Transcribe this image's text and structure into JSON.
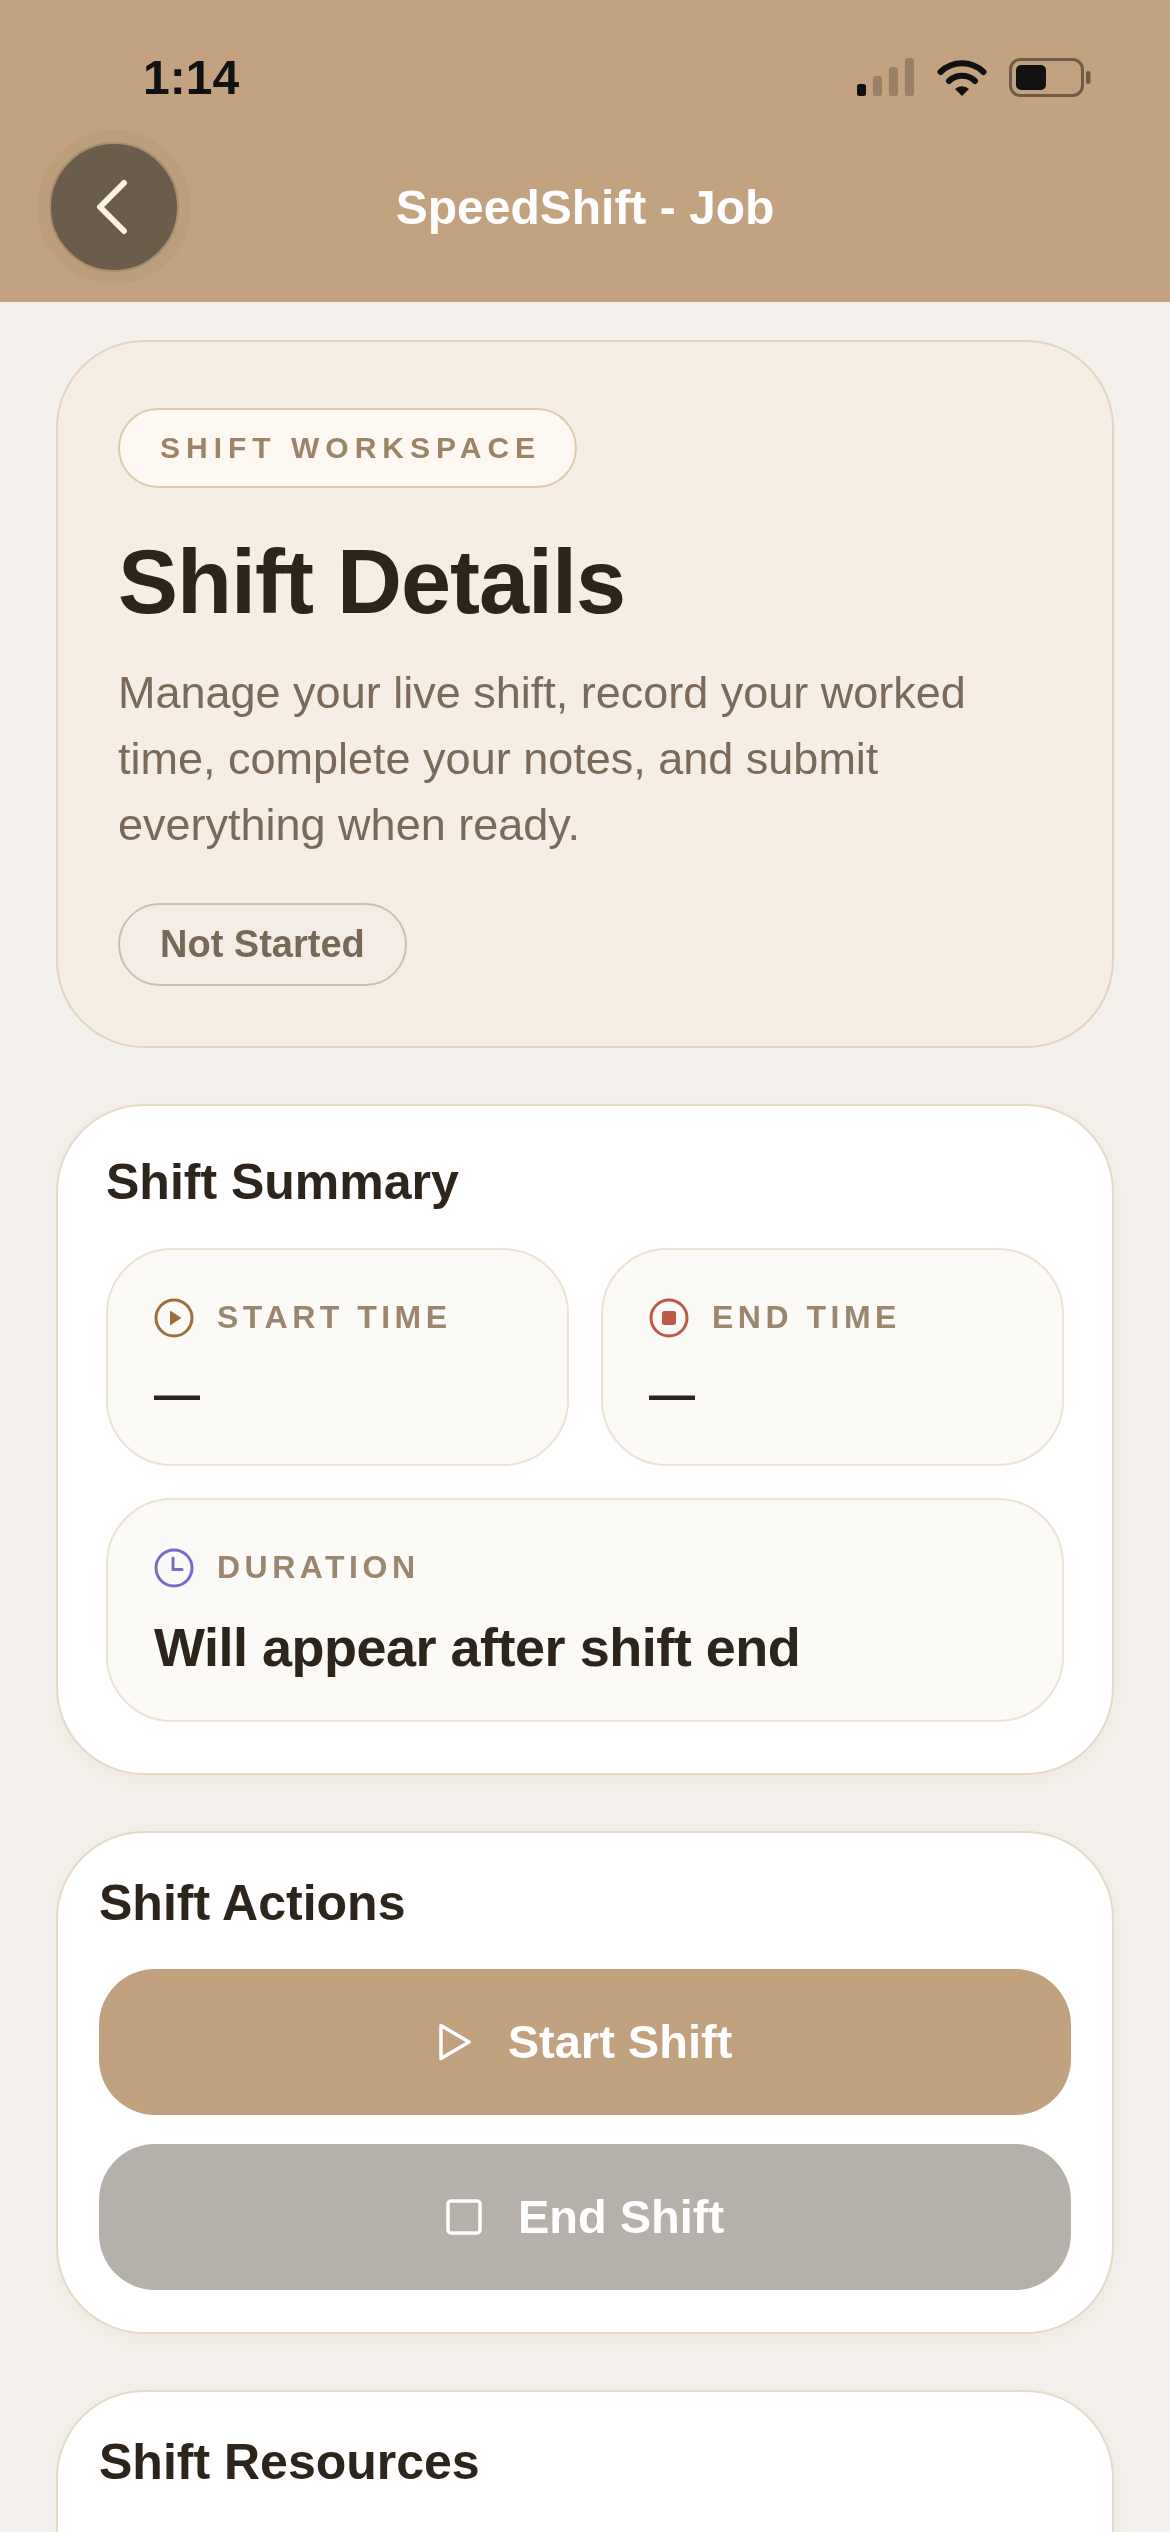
{
  "status_bar": {
    "time": "1:14"
  },
  "header": {
    "title": "SpeedShift - Job"
  },
  "hero": {
    "eyebrow": "SHIFT WORKSPACE",
    "title": "Shift Details",
    "description": "Manage your live shift, record your worked time, complete your notes, and submit everything when ready.",
    "status": "Not Started"
  },
  "summary": {
    "title": "Shift Summary",
    "items": [
      {
        "kind": "start",
        "label": "START TIME",
        "value": "—"
      },
      {
        "kind": "end",
        "label": "END TIME",
        "value": "—"
      },
      {
        "kind": "duration",
        "label": "DURATION",
        "value": "Will appear after shift end"
      }
    ]
  },
  "actions": {
    "title": "Shift Actions",
    "buttons": [
      {
        "kind": "start",
        "label": "Start Shift",
        "disabled": false
      },
      {
        "kind": "end",
        "label": "End Shift",
        "disabled": true
      }
    ]
  },
  "resources": {
    "title": "Shift Resources"
  }
}
